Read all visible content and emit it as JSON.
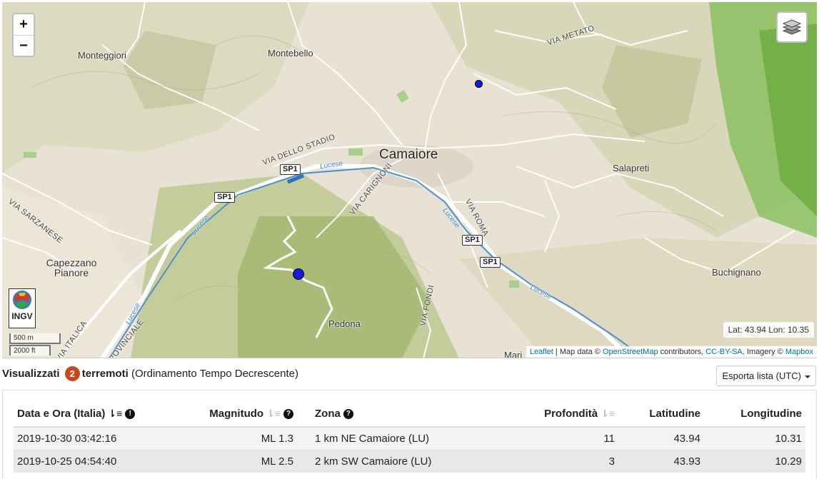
{
  "map": {
    "zoom_in": "+",
    "zoom_out": "−",
    "labels": {
      "montebello": "Montebello",
      "monteggiori": "Monteggiori",
      "camaiore": "Camaiore",
      "salapreti": "Salapreti",
      "capezzano": "Capezzano Pianore",
      "buchignano": "Buchignano",
      "pedona": "Pedona",
      "via_metato": "VIA METATO",
      "via_dello_stadio": "VIA DELLO STADIO",
      "via_carignoni": "VIA CARIGNONI",
      "via_roma": "VIA ROMA",
      "via_sarzanese": "VIA SARZANESE",
      "via_fondi": "VIA FONDI",
      "via_italica": "VIA ITALICA",
      "provinciale": "PROVINCIALE",
      "lucese": "Lucese",
      "mari": "Mari"
    },
    "shields": [
      "SP1",
      "SP1",
      "SP1",
      "SP1"
    ],
    "logo_text": "INGV",
    "scale_m": "500 m",
    "scale_ft": "2000 ft",
    "coords": "Lat: 43.94 Lon: 10.35",
    "attribution": {
      "leaflet": "Leaflet",
      "sep1": " | Map data © ",
      "osm": "OpenStreetMap",
      "sep2": " contributors, ",
      "license": "CC-BY-SA",
      "sep3": ", Imagery © ",
      "mapbox": "Mapbox"
    },
    "quake_color": "#1a1adb"
  },
  "summary": {
    "prefix": "Visualizzati",
    "count": "2",
    "noun": "terremoti",
    "ordering": "(Ordinamento Tempo Decrescente)"
  },
  "export_label": "Esporta lista (UTC)",
  "table": {
    "headers": {
      "datetime": "Data e Ora (Italia)",
      "magnitude": "Magnitudo",
      "zone": "Zona",
      "depth": "Profondità",
      "lat": "Latitudine",
      "lon": "Longitudine"
    },
    "rows": [
      {
        "datetime": "2019-10-30 03:42:16",
        "magnitude": "ML 1.3",
        "zone": "1 km NE Camaiore (LU)",
        "depth": "11",
        "lat": "43.94",
        "lon": "10.31"
      },
      {
        "datetime": "2019-10-25 04:54:40",
        "magnitude": "ML 2.5",
        "zone": "2 km SW Camaiore (LU)",
        "depth": "3",
        "lat": "43.93",
        "lon": "10.29"
      }
    ]
  }
}
